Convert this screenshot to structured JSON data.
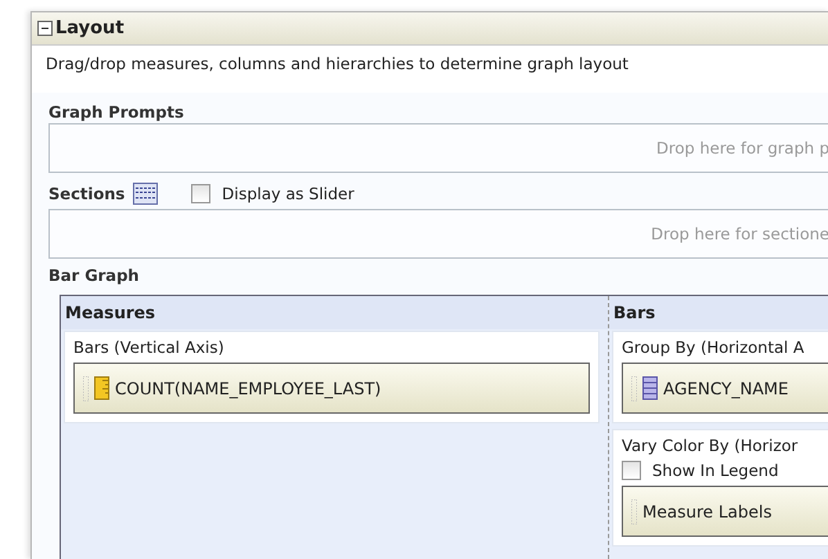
{
  "panel": {
    "title": "Layout",
    "expanded": true,
    "description": "Drag/drop measures, columns and hierarchies to determine graph layout"
  },
  "graph_prompts": {
    "label": "Graph Prompts",
    "placeholder": "Drop here for graph p"
  },
  "sections": {
    "label": "Sections",
    "slider_label": "Display as Slider",
    "slider_checked": false,
    "placeholder": "Drop here for sectione"
  },
  "bar_graph": {
    "label": "Bar Graph",
    "measures": {
      "title": "Measures",
      "axis_label": "Bars (Vertical Axis)",
      "items": [
        {
          "kind": "measure",
          "label": "COUNT(NAME_EMPLOYEE_LAST)"
        }
      ]
    },
    "bars": {
      "title": "Bars",
      "group_label": "Group By (Horizontal A",
      "group_items": [
        {
          "kind": "column",
          "label": "AGENCY_NAME"
        }
      ],
      "vary_label": "Vary Color By (Horizor",
      "legend_label": "Show In Legend",
      "legend_checked": false,
      "vary_items": [
        {
          "kind": "plain",
          "label": "Measure Labels"
        }
      ]
    }
  }
}
